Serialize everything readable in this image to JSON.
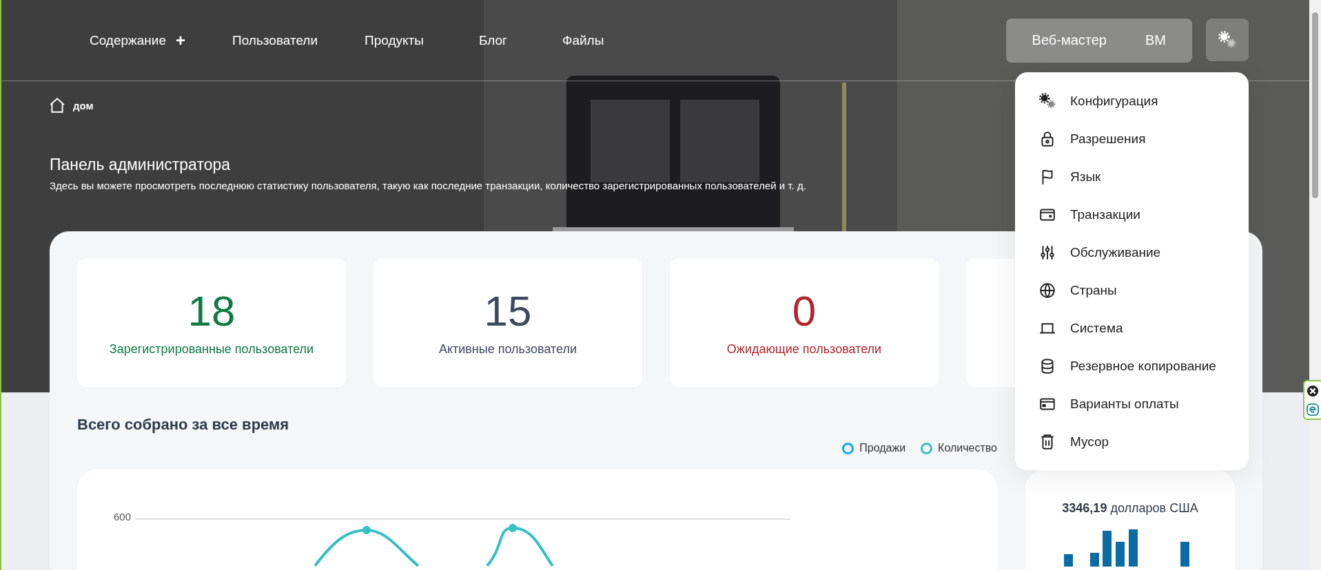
{
  "nav": {
    "items": [
      {
        "label": "Содержание",
        "has_plus": true,
        "plus": "+"
      },
      {
        "label": "Пользователи",
        "has_plus": false
      },
      {
        "label": "Продукты",
        "has_plus": false
      },
      {
        "label": "Блог",
        "has_plus": false
      },
      {
        "label": "Файлы",
        "has_plus": false
      }
    ],
    "user": {
      "name": "Веб-мастер",
      "initials": "BM"
    }
  },
  "breadcrumb": {
    "label": "дом"
  },
  "header": {
    "title": "Панель администратора",
    "subtitle": "Здесь вы можете просмотреть последнюю статистику пользователя, такую как последние транзакции, количество зарегистрированных пользователей и т. д."
  },
  "stats": [
    {
      "value": "18",
      "label": "Зарегистрированные пользователи",
      "color": "#0f7a45"
    },
    {
      "value": "15",
      "label": "Активные пользователи",
      "color": "#3f4a5e"
    },
    {
      "value": "0",
      "label": "Ожидающие пользователи",
      "color": "#b3262d"
    }
  ],
  "collected": {
    "title": "Всего собрано за все время",
    "legend": [
      {
        "label": "Продажи",
        "color": "#0ea5e9"
      },
      {
        "label": "Количество",
        "color": "#36bfc4"
      }
    ],
    "y_tick_label": "600",
    "total": {
      "amount": "3346,19",
      "unit": "долларов США"
    }
  },
  "settings_menu": {
    "items": [
      {
        "label": "Конфигурация",
        "kind": "gears"
      },
      {
        "label": "Разрешения",
        "kind": "lock"
      },
      {
        "label": "Язык",
        "kind": "flag"
      },
      {
        "label": "Транзакции",
        "kind": "wallet"
      },
      {
        "label": "Обслуживание",
        "kind": "sliders"
      },
      {
        "label": "Страны",
        "kind": "globe"
      },
      {
        "label": "Система",
        "kind": "laptop"
      },
      {
        "label": "Резервное копирование",
        "kind": "database"
      },
      {
        "label": "Варианты оплаты",
        "kind": "card"
      },
      {
        "label": "Мусор",
        "kind": "trash"
      }
    ]
  }
}
